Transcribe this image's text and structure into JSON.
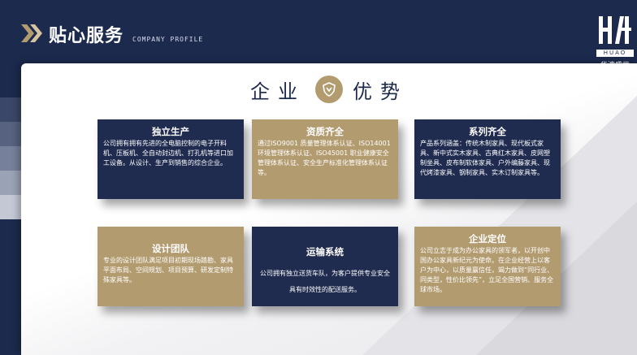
{
  "header": {
    "title": "贴心服务",
    "subtitle": "COMPANY PROFILE"
  },
  "logo": {
    "mark": "HUAO",
    "en": "HUAO",
    "cn": "华澳盛世"
  },
  "section": {
    "heading_left": "企业",
    "heading_right": "优势"
  },
  "cards": [
    {
      "title": "独立生产",
      "body": "公司拥有拥有先进的全电脑控制的电子开料机、压板机、全自动封边机、打孔机等进口加工设备。从设计、生产到销售的综合企业。"
    },
    {
      "title": "资质齐全",
      "body": "通过ISO9001 质量管理体系认证、ISO14001 环境管理体系认证、ISO45001 职业健康安全管理体系认证、安全生产标准化管理体系认证等。"
    },
    {
      "title": "系列齐全",
      "body": "产品系列涵盖：传统木制家具、现代板式家具、新中式实木家具、古典红木家具、皮网塑制坐具、皮布制软体家具、户外编藤家具、现代烤漆家具、钢制家具、实木订制家具等。"
    },
    {
      "title": "设计团队",
      "body": "专业的设计团队满足项目初期现场踏勘、家具平面布局、空间规划、项目预算、研发定制特殊家具等。"
    },
    {
      "title": "运输系统",
      "body": "公司拥有独立送货车队，为客户提供专业安全具有时效性的配送服务。"
    },
    {
      "title": "企业定位",
      "body": "公司立志于成为办公家具的领军者，以开创中国办公家具新纪元为使命。在企业经营上以客户为中心，以质量赢信任，竭力做到“同行业、同类型，性价比领先”，立足全国营销、服务全球市场。"
    }
  ],
  "colors": {
    "navy": "#1f2b4f",
    "gold": "#b39b70",
    "background": "#1c2a4e"
  }
}
